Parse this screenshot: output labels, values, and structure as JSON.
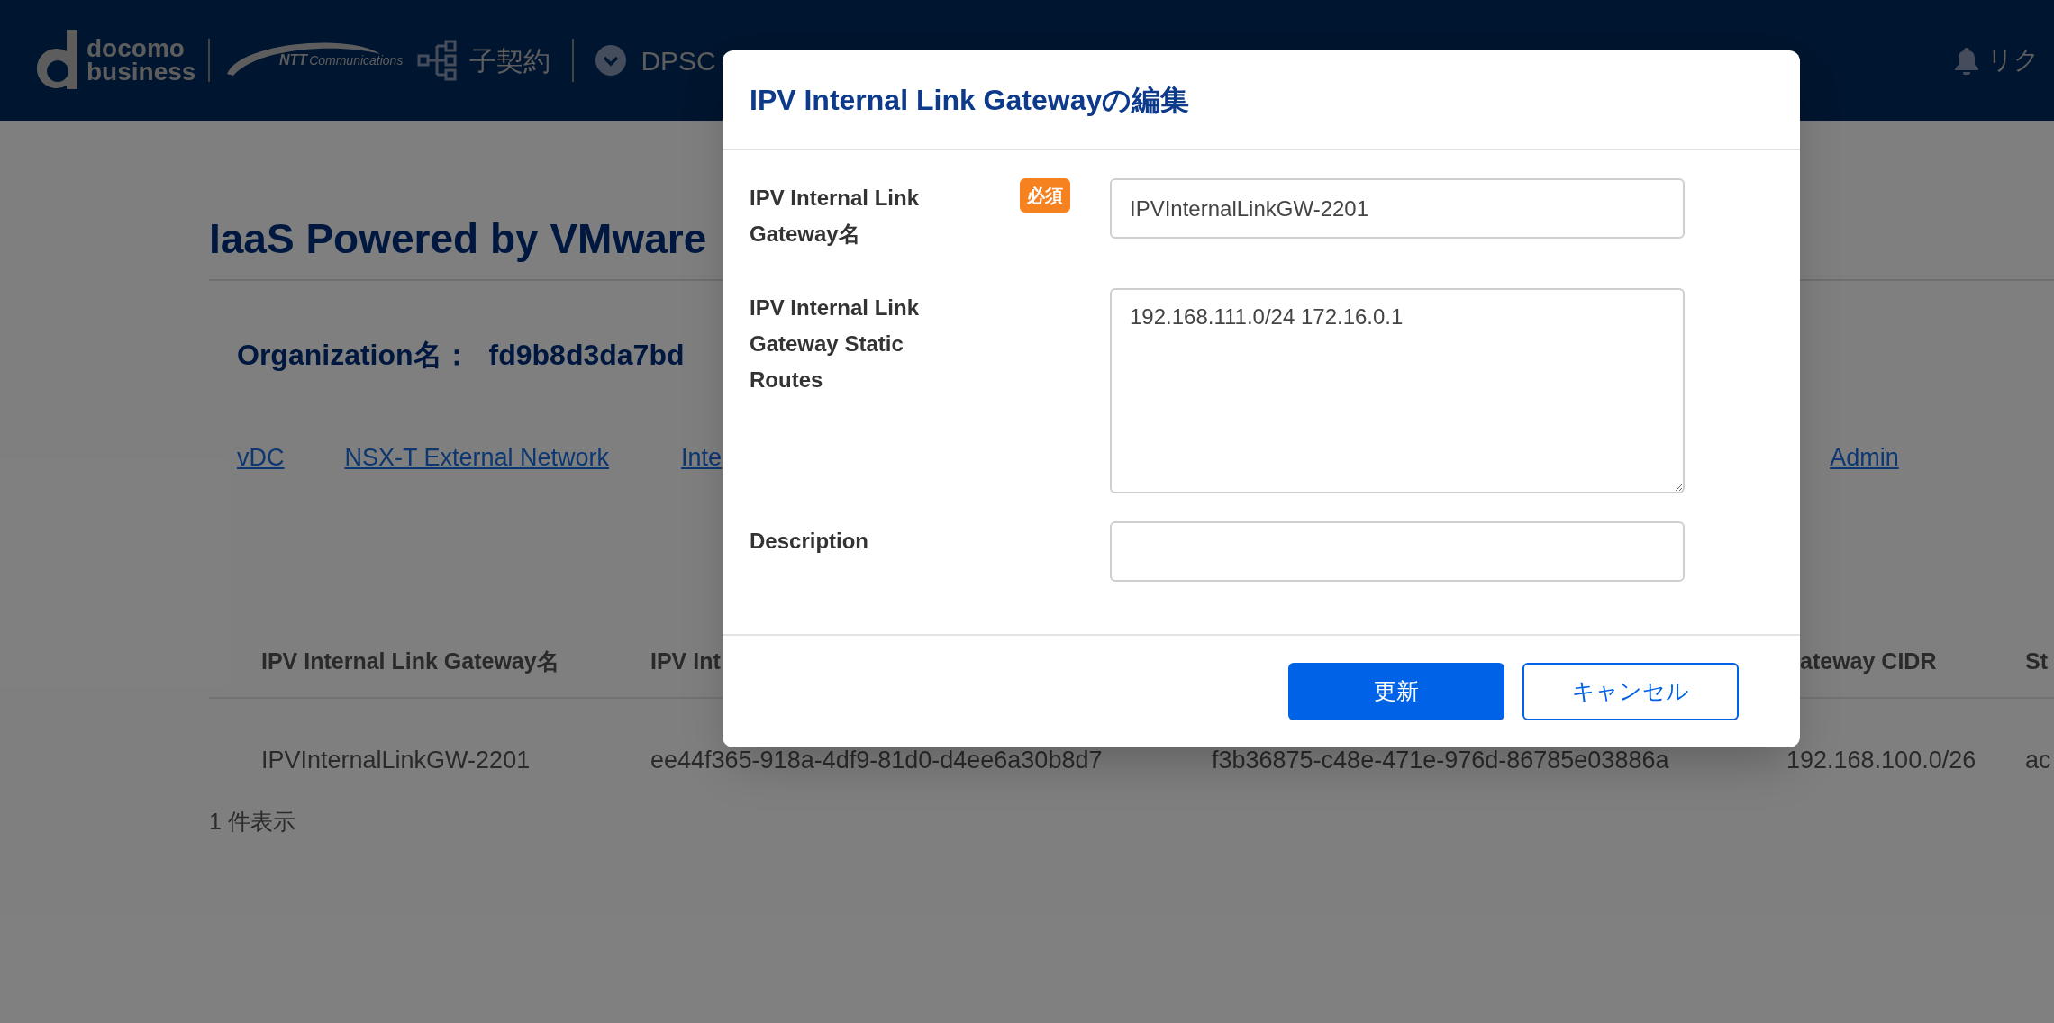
{
  "header": {
    "brand": {
      "line1": "docomo",
      "line2": "business"
    },
    "partner": {
      "mark": "NTT",
      "name": "Communications"
    },
    "contract_link": "子契約",
    "service_menu": "DPSC",
    "notifications": "リク"
  },
  "page": {
    "title": "IaaS Powered by VMware",
    "organization": {
      "label": "Organization名：",
      "value": "fd9b8d3da7bd"
    },
    "links": [
      "vDC",
      "NSX-T External Network",
      "Inte",
      "Admin"
    ],
    "table": {
      "columns": [
        {
          "header": "IPV Internal Link Gateway名"
        },
        {
          "header": "IPV Int"
        },
        {},
        {
          "header": "ateway CIDR"
        },
        {
          "header": "St"
        }
      ],
      "rows": [
        [
          "IPVInternalLinkGW-2201",
          "ee44f365-918a-4df9-81d0-d4ee6a30b8d7",
          "f3b36875-c48e-471e-976d-86785e03886a",
          "192.168.100.0/26",
          "ac"
        ]
      ]
    },
    "count": "1 件表示"
  },
  "dialog": {
    "title": "IPV Internal Link Gatewayの編集",
    "fields": [
      {
        "kind": "input",
        "label": "IPV Internal Link Gateway名",
        "required": true,
        "badge": "必須",
        "value": "IPVInternalLinkGW-2201"
      },
      {
        "kind": "textarea",
        "label": "IPV Internal Link Gateway Static Routes",
        "required": false,
        "value": "192.168.111.0/24 172.16.0.1"
      },
      {
        "kind": "input",
        "label": "Description",
        "required": false
      }
    ],
    "buttons": [
      {
        "label": "更新",
        "kind": "primary"
      },
      {
        "label": "キャンセル",
        "kind": "secondary"
      }
    ]
  }
}
